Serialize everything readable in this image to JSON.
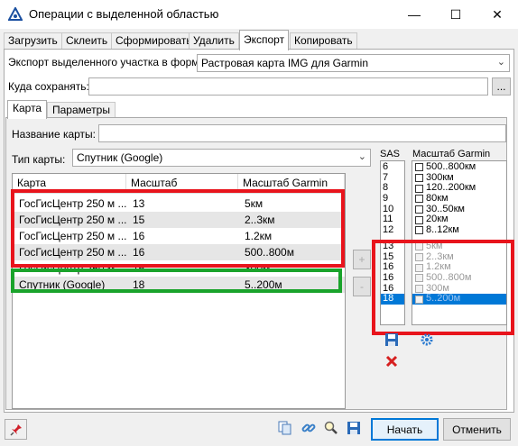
{
  "window": {
    "title": "Операции с выделенной областью",
    "minimize_glyph": "—",
    "maximize_glyph": "☐",
    "close_glyph": "✕"
  },
  "tabs": [
    "Загрузить",
    "Склеить",
    "Сформировать",
    "Удалить",
    "Экспорт",
    "Копировать"
  ],
  "export": {
    "format_label": "Экспорт выделенного участка в формат",
    "format_value": "Растровая карта IMG для Garmin",
    "save_label": "Куда сохранять:",
    "save_value": "",
    "browse_label": "..."
  },
  "inner_tabs": [
    "Карта",
    "Параметры"
  ],
  "map": {
    "name_label": "Название карты:",
    "name_value": "",
    "type_label": "Тип карты:",
    "type_value": "Спутник (Google)"
  },
  "grid": {
    "headers": [
      "Карта",
      "Масштаб",
      "Масштаб Garmin"
    ],
    "rows": [
      [
        "ГосГисЦентр 250 м ...",
        "13",
        "5км"
      ],
      [
        "ГосГисЦентр 250 м ...",
        "15",
        "2..3км"
      ],
      [
        "ГосГисЦентр 250 м ...",
        "16",
        "1.2км"
      ],
      [
        "ГосГисЦентр 250 м ...",
        "16",
        "500..800м"
      ],
      [
        "ГосГисЦентр 250 м ...",
        "16",
        "300м"
      ],
      [
        "Спутник (Google)",
        "18",
        "5..200м"
      ]
    ],
    "add_label": "+",
    "remove_label": "-"
  },
  "sas": {
    "label": "SAS",
    "levels": [
      "6",
      "7",
      "8",
      "9",
      "10",
      "11",
      "12",
      "13",
      "15",
      "16",
      "16",
      "16",
      "18"
    ],
    "selected_index": 12
  },
  "garmin": {
    "label": "Масштаб Garmin",
    "scales": [
      "500..800км",
      "300км",
      "120..200км",
      "80км",
      "30..50км",
      "20км",
      "8..12км",
      "5км",
      "2..3км",
      "1.2км",
      "500..800м",
      "300м",
      "5..200м"
    ],
    "disabled_from_index": 7,
    "selected_index": 12
  },
  "buttons": {
    "start": "Начать",
    "cancel": "Отменить"
  },
  "colors": {
    "highlight_red": "#e8141c",
    "highlight_green": "#1aa32b",
    "selection_blue": "#0078d7"
  },
  "icons": [
    "app-icon",
    "pin-icon",
    "copy-icon",
    "link-icon",
    "zoom-icon",
    "save-icon",
    "save-settings-icon",
    "delete-icon",
    "settings-icon"
  ]
}
